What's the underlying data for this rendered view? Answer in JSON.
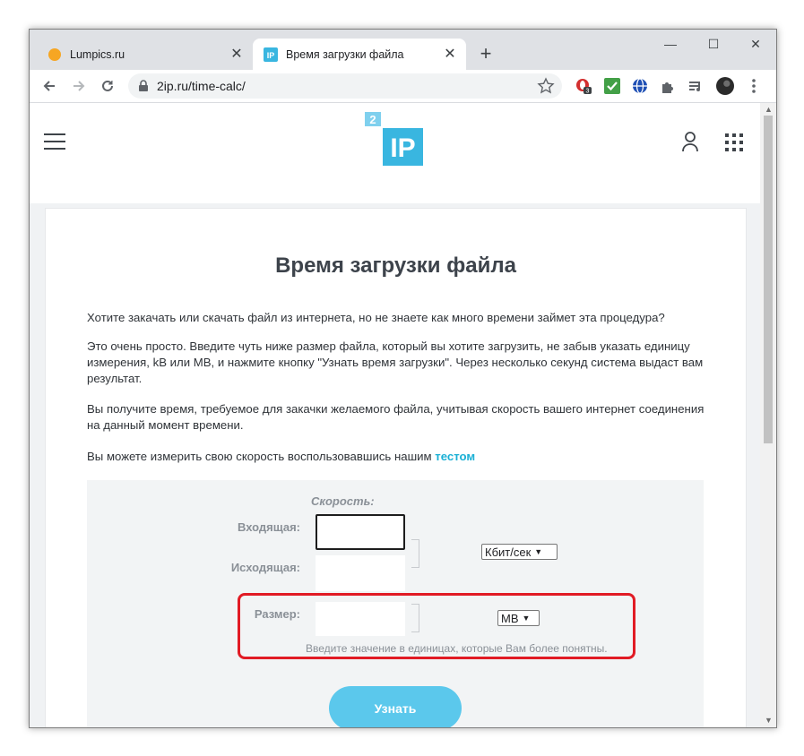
{
  "browser": {
    "tabs": [
      {
        "title": "Lumpics.ru",
        "close": "✕"
      },
      {
        "title": "Время загрузки файла",
        "favicon_text": "IP",
        "close": "✕"
      }
    ],
    "new_tab": "+",
    "window_controls": {
      "minimize": "—",
      "maximize": "☐",
      "close": "✕"
    },
    "url": "2ip.ru/time-calc/",
    "extension_badge": "3"
  },
  "site": {
    "logo_top": "2",
    "logo_main": "IP"
  },
  "page": {
    "title": "Время загрузки файла",
    "para1": "Хотите закачать или скачать файл из интернета, но не знаете как много времени займет эта процедура?",
    "para2": "Это очень просто. Введите чуть ниже размер файла, который вы хотите загрузить, не забыв указать единицу измерения, kB или MB, и нажмите кнопку \"Узнать время загрузки\". Через несколько секунд система выдаст вам результат.",
    "para3": "Вы получите время, требуемое для закачки желаемого файла, учитывая скорость вашего интернет соединения на данный момент времени.",
    "para4_text": "Вы можете измерить свою скорость воспользовавшись нашим ",
    "para4_link": "тестом"
  },
  "form": {
    "speed_title": "Скорость:",
    "incoming_label": "Входящая:",
    "outgoing_label": "Исходящая:",
    "incoming_value": "",
    "outgoing_value": "",
    "speed_unit": "Кбит/сек",
    "size_label": "Размер:",
    "size_value": "",
    "size_unit": "MB",
    "hint": "Введите значение в единицах, которые Вам более понятны.",
    "submit": "Узнать"
  },
  "colors": {
    "accent": "#5bc8ec",
    "link": "#1ab0d5",
    "highlight": "#e11b24"
  }
}
